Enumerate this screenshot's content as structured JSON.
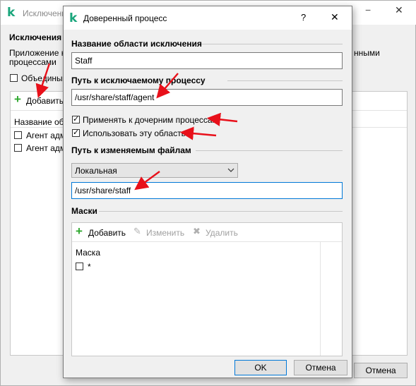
{
  "background_window": {
    "title": "Исключени",
    "section_title": "Исключения",
    "description_line1": "Приложение не",
    "description_right": "нными",
    "description_line2": "процессами",
    "merge_checkbox_label": "Объедины",
    "add_button": "Добавить",
    "table_header": "Название обл",
    "rows": [
      "Агент адм",
      "Агент адм"
    ],
    "cancel_button": "Отмена"
  },
  "dialog": {
    "title": "Доверенный процесс",
    "help_glyph": "?",
    "close_glyph": "✕",
    "scope_name_label": "Название области исключения",
    "scope_name_value": "Staff",
    "process_path_label": "Путь к исключаемому процессу",
    "process_path_value": "/usr/share/staff/agent",
    "apply_children_label": "Применять к дочерним процессам",
    "apply_children_checked": true,
    "use_scope_label": "Использовать эту область",
    "use_scope_checked": true,
    "files_path_label": "Путь к изменяемым файлам",
    "location_select_value": "Локальная",
    "files_path_value": "/usr/share/staff",
    "masks_label": "Маски",
    "masks_toolbar": {
      "add": "Добавить",
      "edit": "Изменить",
      "delete": "Удалить"
    },
    "masks_table_header": "Маска",
    "masks_rows": [
      "*"
    ],
    "ok_button": "OK",
    "cancel_button": "Отмена"
  },
  "colors": {
    "kaspersky_green": "#1aa67c",
    "add_plus_green": "#2fa82f",
    "arrow_red": "#e8101a",
    "focus_blue": "#0078d7"
  }
}
